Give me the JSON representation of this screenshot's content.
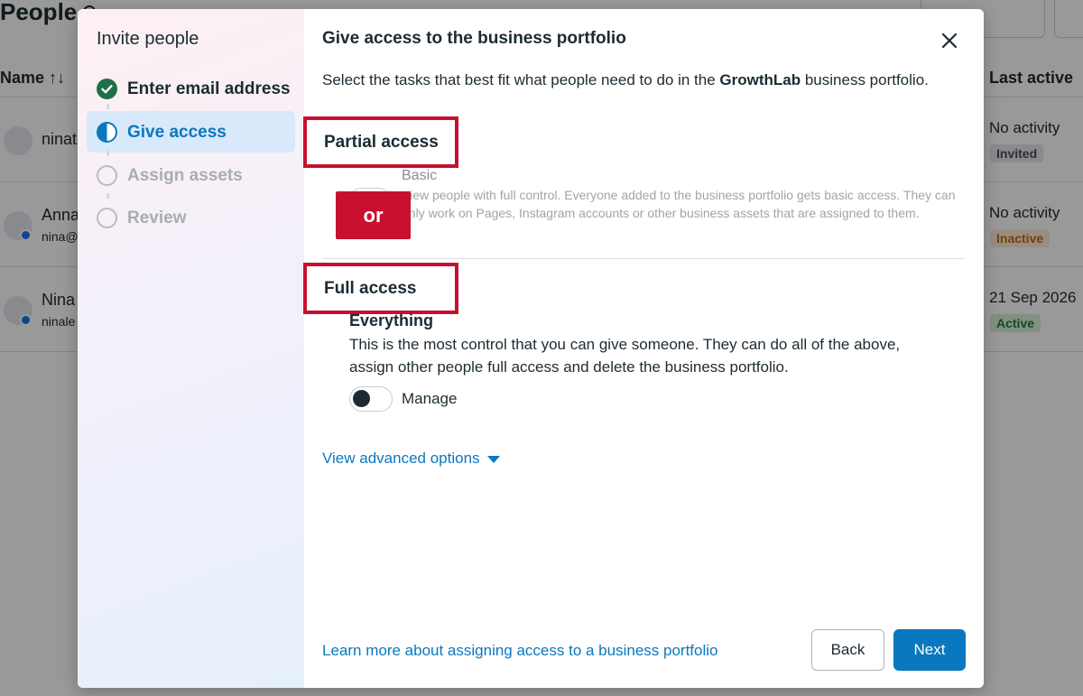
{
  "background": {
    "page_title": "People",
    "columns": {
      "name": "Name ↑↓",
      "last_active": "Last active"
    },
    "rows": [
      {
        "name": "ninat",
        "email": "",
        "activity": "No activity",
        "status": "Invited"
      },
      {
        "name": "Anna",
        "email": "nina@",
        "activity": "No activity",
        "status": "Inactive"
      },
      {
        "name": "Nina",
        "email": "ninale",
        "activity": "21 Sep 2026",
        "status": "Active"
      }
    ]
  },
  "modal": {
    "left_title": "Invite people",
    "steps": [
      {
        "label": "Enter email address",
        "state": "done"
      },
      {
        "label": "Give access",
        "state": "active"
      },
      {
        "label": "Assign assets",
        "state": "todo"
      },
      {
        "label": "Review",
        "state": "todo"
      }
    ],
    "title": "Give access to the business portfolio",
    "intro_prefix": "Select the tasks that best fit what people need to do in the ",
    "intro_bold": "GrowthLab",
    "intro_suffix": " business portfolio.",
    "partial_access": {
      "heading": "Partial access",
      "basic_title": "Basic",
      "basic_desc": "View people with full control. Everyone added to the business portfolio gets basic access. They can only work on Pages, Instagram accounts or other business assets that are assigned to them."
    },
    "or_label": "or",
    "full_access": {
      "heading": "Full access",
      "everything_title": "Everything",
      "everything_desc": "This is the most control that you can give someone. They can do all of the above, assign other people full access and delete the business portfolio.",
      "toggle_label": "Manage"
    },
    "advanced_link": "View advanced options",
    "learn_more_link": "Learn more about assigning access to a business portfolio",
    "back_button": "Back",
    "next_button": "Next"
  },
  "colors": {
    "accent": "#0a78be",
    "highlight": "#c8102e",
    "done": "#1f6f4a"
  },
  "icons": {
    "close": "close-icon",
    "caret": "caret-down-icon",
    "check": "check-icon"
  }
}
